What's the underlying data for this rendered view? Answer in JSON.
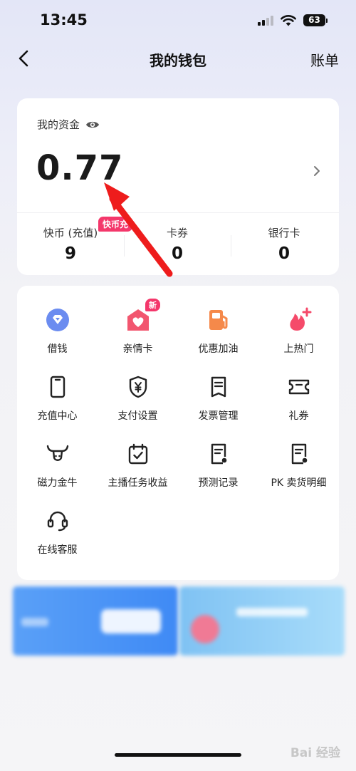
{
  "status_bar": {
    "time": "13:45",
    "battery": "63"
  },
  "nav": {
    "title": "我的钱包",
    "bill_label": "账单"
  },
  "funds": {
    "label": "我的资金",
    "balance": "0.77",
    "stats": [
      {
        "label": "快币 (充值)",
        "value": "9"
      },
      {
        "label": "卡券",
        "value": "0"
      },
      {
        "label": "银行卡",
        "value": "0"
      }
    ],
    "recharge_badge": "快币充"
  },
  "services": {
    "new_badge": "新",
    "items": [
      {
        "label": "借钱",
        "icon": "loan-icon",
        "color": "#6b8cf0"
      },
      {
        "label": "亲情卡",
        "icon": "family-card-icon",
        "color": "#f2566f"
      },
      {
        "label": "优惠加油",
        "icon": "fuel-pump-icon",
        "color": "#f5894a"
      },
      {
        "label": "上热门",
        "icon": "flame-icon",
        "color": "#f54a6a"
      },
      {
        "label": "充值中心",
        "icon": "phone-icon",
        "color": "#222222"
      },
      {
        "label": "支付设置",
        "icon": "shield-yen-icon",
        "color": "#222222"
      },
      {
        "label": "发票管理",
        "icon": "invoice-icon",
        "color": "#222222"
      },
      {
        "label": "礼券",
        "icon": "ticket-icon",
        "color": "#222222"
      },
      {
        "label": "磁力金牛",
        "icon": "bull-icon",
        "color": "#222222"
      },
      {
        "label": "主播任务收益",
        "icon": "calendar-check-icon",
        "color": "#222222"
      },
      {
        "label": "预测记录",
        "icon": "record-icon",
        "color": "#222222"
      },
      {
        "label": "PK 卖货明细",
        "icon": "sales-detail-icon",
        "color": "#222222"
      },
      {
        "label": "在线客服",
        "icon": "headset-icon",
        "color": "#222222"
      }
    ]
  },
  "watermark": "Bai 经验"
}
